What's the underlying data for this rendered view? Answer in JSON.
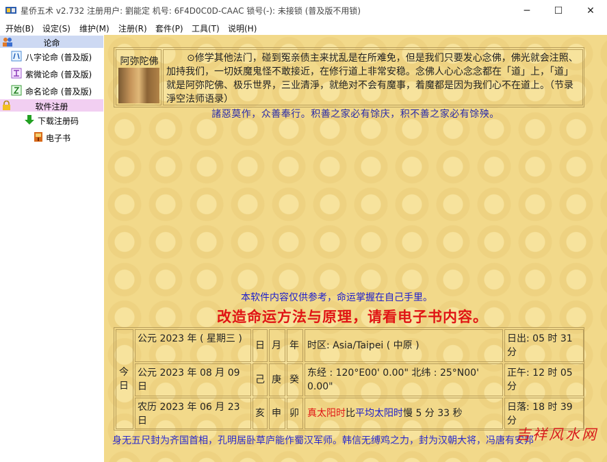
{
  "window": {
    "title": "星侨五术 v2.732  注册用户: 劉能定  机号: 6F4D0C0D-CAAC  锁号(-): 未接锁 (普及版不用锁)",
    "minimize": "─",
    "maximize": "☐",
    "close": "✕"
  },
  "menu": [
    "开始(B)",
    "设定(S)",
    "维护(M)",
    "注册(R)",
    "套件(P)",
    "工具(T)",
    "说明(H)"
  ],
  "sidebar": {
    "header1": "论命",
    "items1": [
      {
        "label": "八字论命 (普及版)",
        "icon": "bazi-icon"
      },
      {
        "label": "紫微论命 (普及版)",
        "icon": "ziwei-icon"
      },
      {
        "label": "命名论命 (普及版)",
        "icon": "naming-icon"
      }
    ],
    "header2": "软件注册",
    "items2": [
      {
        "label": "下载注册码",
        "icon": "download-arrow-icon"
      },
      {
        "label": "电子书",
        "icon": "ebook-icon"
      }
    ]
  },
  "quote": {
    "name": "阿弥陀佛",
    "text": "⊙修学其他法门，碰到冤亲债主来扰乱是在所难免，但是我们只要发心念佛，佛光就会注照、加持我们，一切妖魔鬼怪不敢接近，在修行道上非常安稳。念佛人心心念念都在「道」上，「道」就是阿弥陀佛、极乐世界，三业清淨，就绝对不会有魔事，着魔都是因为我们心不在道上。（节录  淨空法师语录）"
  },
  "motto": "諸惡莫作，众善奉行。积善之家必有馀庆，积不善之家必有馀殃。",
  "disclaimer": "本软件内容仅供参考，命运掌握在自己手里。",
  "headline": "改造命运方法与原理，请看电子书内容。",
  "date_table": {
    "today": "今日",
    "row1": {
      "date": "公元 2023 年 ( 星期三 )",
      "g1": "日",
      "g2": "月",
      "g3": "年",
      "info": "时区: Asia/Taipei ( 中原 )",
      "sun": "日出: 05 时 31 分"
    },
    "row2": {
      "date": "公元 2023 年 08 月 09 日",
      "g1": "己",
      "g2": "庚",
      "g3": "癸",
      "info": "东经 : 120°E00' 0.00\" 北纬 : 25°N00' 0.00\"",
      "sun": "正午: 12 时 05 分"
    },
    "row3": {
      "date": "农历 2023 年 06 月 23 日",
      "g1": "亥",
      "g2": "申",
      "g3": "卯",
      "true_solar": "真太阳时",
      "mid": "比",
      "mean_solar": "平均太阳时",
      "diff": "慢 5 分 33 秒",
      "sun": "日落: 18 时 39 分"
    }
  },
  "scroll_text": "身无五尺封为齐国首相，孔明居卧草庐能作蜀汉军师。韩信无缚鸡之力，封为汉朝大将，冯唐有安邦",
  "watermark": "吉祥风水网"
}
